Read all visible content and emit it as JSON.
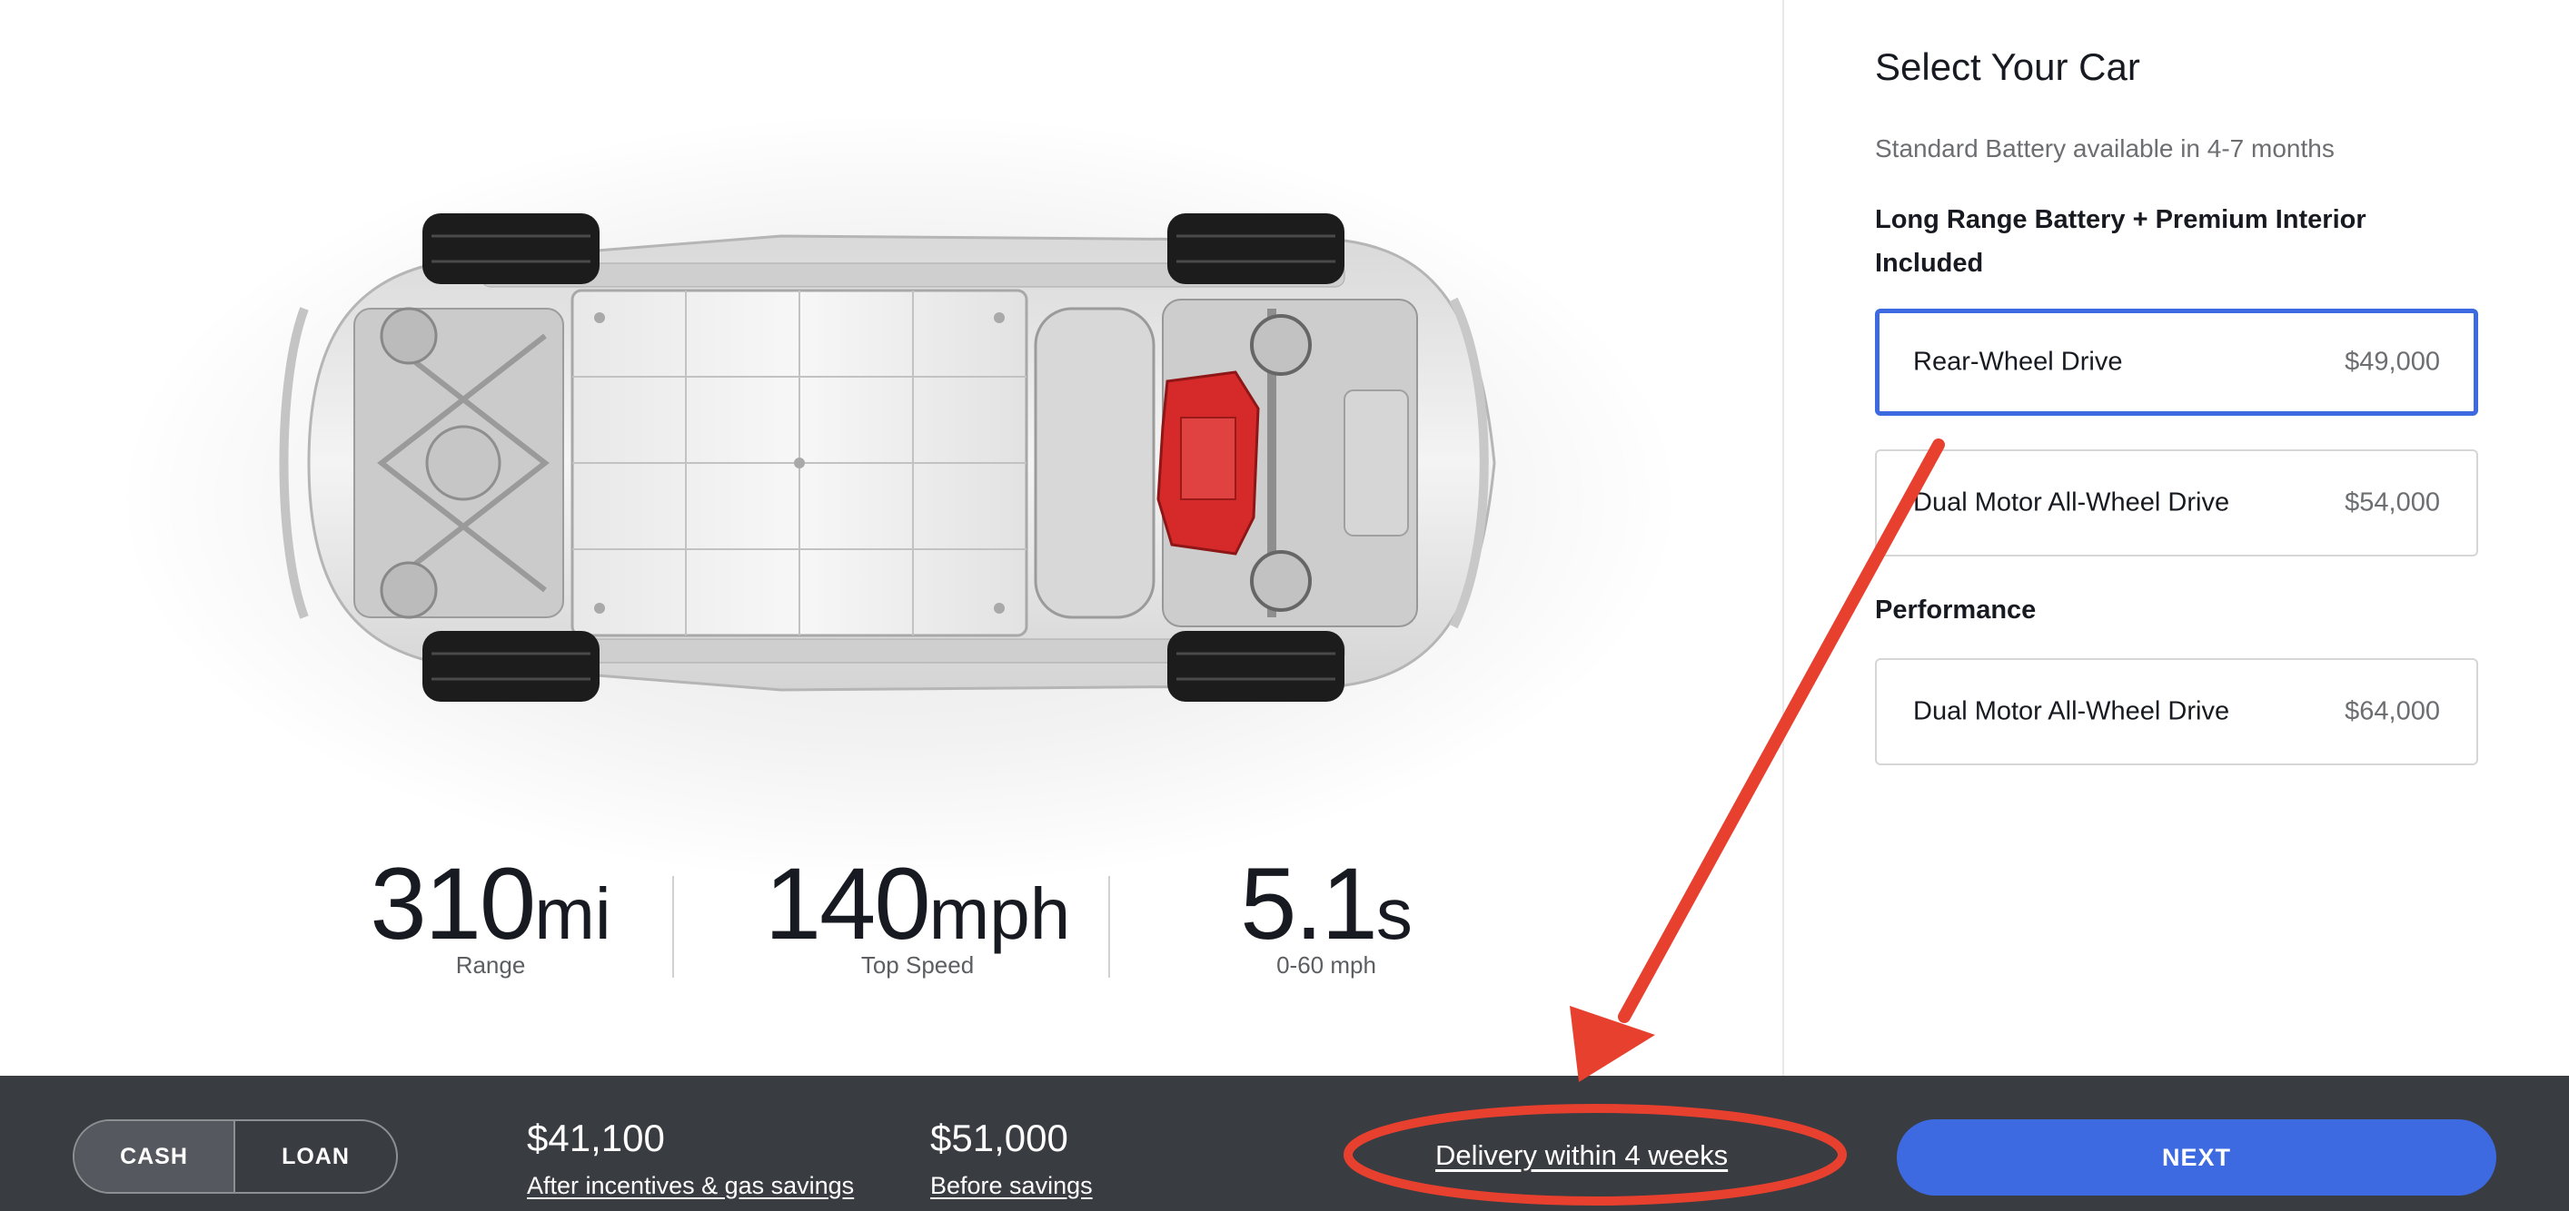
{
  "stats": [
    {
      "value": "310",
      "unit": "mi",
      "label": "Range"
    },
    {
      "value": "140",
      "unit": "mph",
      "label": "Top Speed"
    },
    {
      "value": "5.1",
      "unit": "s",
      "label": "0-60 mph"
    }
  ],
  "panel": {
    "title": "Select Your Car",
    "availability_note": "Standard Battery available in 4-7 months",
    "groups": [
      {
        "label": "Long Range Battery + Premium Interior Included",
        "options": [
          {
            "name": "Rear-Wheel Drive",
            "price": "$49,000",
            "selected": true
          },
          {
            "name": "Dual Motor All-Wheel Drive",
            "price": "$54,000",
            "selected": false
          }
        ]
      },
      {
        "label": "Performance",
        "options": [
          {
            "name": "Dual Motor All-Wheel Drive",
            "price": "$64,000",
            "selected": false
          }
        ]
      }
    ]
  },
  "bottom_bar": {
    "payment_toggle": {
      "options": [
        "CASH",
        "LOAN"
      ],
      "selected": "CASH"
    },
    "price_after": {
      "amount": "$41,100",
      "label": "After incentives & gas savings"
    },
    "price_before": {
      "amount": "$51,000",
      "label": "Before savings"
    },
    "delivery": "Delivery within 4 weeks",
    "next_label": "NEXT"
  },
  "colors": {
    "accent_blue": "#3e6ae1",
    "bar_background": "#393c41",
    "annotation_red": "#e8402f",
    "motor_red": "#d62a2a"
  },
  "icons": [
    "car-chassis-illustration",
    "annotation-arrow",
    "annotation-ellipse"
  ]
}
